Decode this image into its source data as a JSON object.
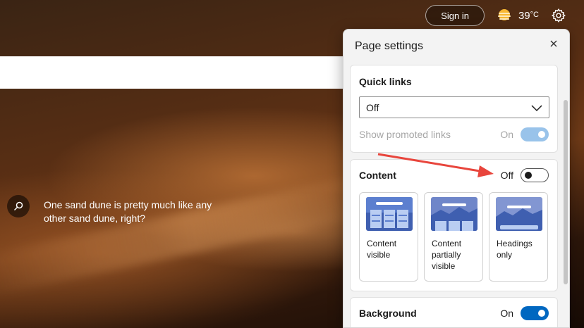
{
  "top_bar": {
    "sign_in_label": "Sign in",
    "temperature": "39",
    "temperature_unit": "°C",
    "weather_icon": "sun-haze-icon",
    "settings_icon": "gear-icon"
  },
  "image_caption": {
    "text": "One sand dune is pretty much like any other sand dune, right?",
    "search_icon": "search-icon"
  },
  "panel": {
    "title": "Page settings",
    "close_icon": "close-icon",
    "quick_links": {
      "title": "Quick links",
      "selected": "Off",
      "promoted_label": "Show promoted links",
      "promoted_state": "On"
    },
    "content": {
      "title": "Content",
      "state": "Off",
      "layouts": [
        {
          "label": "Content visible"
        },
        {
          "label": "Content partially visible"
        },
        {
          "label": "Headings only"
        }
      ]
    },
    "background": {
      "title": "Background",
      "state": "On"
    }
  },
  "colors": {
    "accent": "#0067c0",
    "annotation_arrow": "#e8453c",
    "panel_bg": "#f3f3f3"
  }
}
